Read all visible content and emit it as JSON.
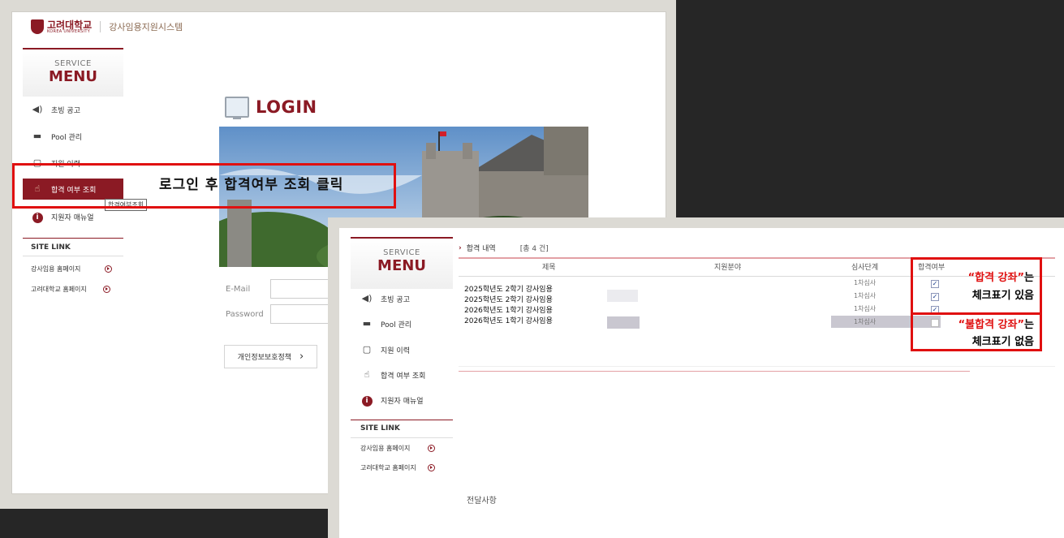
{
  "brand": {
    "logo_ko": "고려대학교",
    "logo_en": "KOREA UNIVERSITY",
    "system_name": "강사임용지원시스템",
    "color": "#8b1a24"
  },
  "menu": {
    "service_label": "SERVICE",
    "menu_label": "MENU",
    "items": [
      {
        "label": "초빙 공고",
        "icon": "speaker-icon"
      },
      {
        "label": "Pool 관리",
        "icon": "monitor-icon"
      },
      {
        "label": "지원 이력",
        "icon": "clipboard-icon"
      },
      {
        "label": "합격 여부 조회",
        "icon": "hand-pointer-icon"
      },
      {
        "label": "지원자 매뉴얼",
        "icon": "info-icon"
      }
    ],
    "tooltip": "합격여부조회",
    "site_link": {
      "title": "SITE LINK",
      "items": [
        "강사임용 홈페이지",
        "고려대학교 홈페이지"
      ]
    }
  },
  "login": {
    "title": "LOGIN",
    "email_label": "E-Mail",
    "password_label": "Password",
    "privacy_button": "개인정보보호정책",
    "privacy_arrow": "›"
  },
  "callout_login": {
    "text": "로그인 후 합격여부 조회 클릭"
  },
  "results": {
    "title": "합격 내역",
    "count": "[총     4 건]",
    "columns": [
      "제목",
      "지원분야",
      "심사단계",
      "합격여부"
    ],
    "rows": [
      {
        "title": "2025학년도 2학기 강사임용",
        "stage": "1차심사",
        "passed": true
      },
      {
        "title": "2025학년도 2학기 강사임용",
        "stage": "1차심사",
        "passed": true
      },
      {
        "title": "2026학년도 1학기 강사임용",
        "stage": "1차심사",
        "passed": true
      },
      {
        "title": "2026학년도 1학기 강사임용",
        "stage": "1차심사",
        "passed": false
      }
    ],
    "check_mark": "✓",
    "notice": "전달사항"
  },
  "callout_result": {
    "pass_quote": "“합격 강좌”",
    "pass_suffix": "는",
    "pass_line2": "체크표기 있음",
    "fail_quote": "“불합격 강좌”",
    "fail_suffix": "는",
    "fail_line2": "체크표기 없음"
  }
}
